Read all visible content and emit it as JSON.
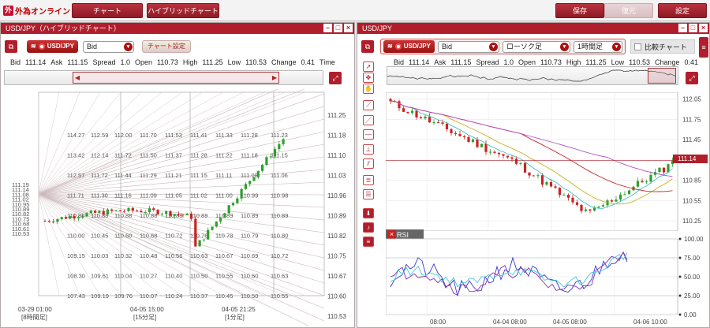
{
  "app": {
    "logo_text": "外為オンライン",
    "logo_mark": "外",
    "top_buttons": {
      "chart": "チャート",
      "hybrid": "ハイブリッドチャート",
      "save": "保存",
      "restore": "復元",
      "settings": "設定"
    }
  },
  "left_panel": {
    "title": "USD/JPY（ハイブリッドチャート）",
    "symbol": "USD/JPY",
    "price_type": "Bid",
    "chart_settings_label": "チャート設定",
    "quote": {
      "bid_label": "Bid",
      "bid": "111.14",
      "ask_label": "Ask",
      "ask": "111.15",
      "spread_label": "Spread",
      "spread": "1.0",
      "open_label": "Open",
      "open": "110.73",
      "high_label": "High",
      "high": "111.25",
      "low_label": "Low",
      "low": "110.53",
      "change_label": "Change",
      "change": "0.41",
      "time_label": "Time"
    }
  },
  "right_panel": {
    "title": "USD/JPY",
    "symbol": "USD/JPY",
    "price_type": "Bid",
    "chart_type": "ローソク足",
    "interval": "1時間足",
    "compare_label": "比較チャート",
    "quote": {
      "bid_label": "Bid",
      "bid": "111.14",
      "ask_label": "Ask",
      "ask": "111.15",
      "spread_label": "Spread",
      "spread": "1.0",
      "open_label": "Open",
      "open": "110.73",
      "high_label": "High",
      "high": "111.25",
      "low_label": "Low",
      "low": "110.53",
      "change_label": "Change",
      "change": "0.41"
    },
    "current_price": "111.14",
    "rsi_label": "RSI"
  },
  "colors": {
    "accent": "#b01e2c",
    "bull": "#2e9e2e",
    "bear": "#cc2222"
  },
  "chart_data": [
    {
      "type": "candlestick",
      "name": "hybrid",
      "y_axis_ticks": [
        "111.25",
        "111.18",
        "111.10",
        "111.03",
        "110.96",
        "110.89",
        "110.82",
        "110.75",
        "110.67",
        "110.60",
        "110.53"
      ],
      "gann_levels_left": [
        "111.19",
        "111.14",
        "111.08",
        "111.02",
        "110.95",
        "110.89",
        "110.82",
        "110.75",
        "110.68",
        "110.61",
        "110.53"
      ],
      "grid_rows": [
        [
          "114.27",
          "112.59",
          "112.00",
          "111.70",
          "111.53",
          "111.41",
          "111.33",
          "111.28",
          "111.23"
        ],
        [
          "113.42",
          "112.14",
          "111.72",
          "111.50",
          "111.37",
          "111.28",
          "111.22",
          "111.18",
          "111.15"
        ],
        [
          "112.57",
          "111.72",
          "111.44",
          "111.29",
          "111.21",
          "111.15",
          "111.11",
          "111.08",
          "111.06"
        ],
        [
          "111.71",
          "111.30",
          "111.16",
          "111.09",
          "111.05",
          "111.02",
          "111.00",
          "110.99",
          "110.98"
        ],
        [
          "110.86",
          "110.88",
          "110.88",
          "110.88",
          "110.88",
          "110.89",
          "110.89",
          "110.89",
          "110.89"
        ],
        [
          "110.00",
          "110.45",
          "110.60",
          "110.68",
          "110.72",
          "110.76",
          "110.78",
          "110.79",
          "110.80"
        ],
        [
          "109.15",
          "110.03",
          "110.32",
          "110.48",
          "110.56",
          "110.63",
          "110.67",
          "110.69",
          "110.72"
        ],
        [
          "108.30",
          "109.61",
          "110.04",
          "110.27",
          "110.40",
          "110.50",
          "110.55",
          "110.60",
          "110.63"
        ],
        [
          "107.43",
          "109.19",
          "109.76",
          "110.07",
          "110.24",
          "110.37",
          "110.45",
          "110.50",
          "110.55"
        ]
      ],
      "x_labels": [
        "03-29 01:00\n[8時間足]",
        "04-05 15:00\n[15分足]",
        "04-05 21:25\n[1分足]"
      ]
    },
    {
      "type": "candlestick",
      "name": "main",
      "y_axis_ticks": [
        "112.05",
        "111.75",
        "111.45",
        "111.15",
        "110.85",
        "110.55",
        "110.25"
      ],
      "x_labels": [
        "08:00",
        "04-04 08:00",
        "04-05 08:00",
        "04-06 10:00"
      ],
      "rsi_ticks": [
        "100.00",
        "75.00",
        "50.00",
        "25.00",
        "0.00"
      ]
    }
  ]
}
